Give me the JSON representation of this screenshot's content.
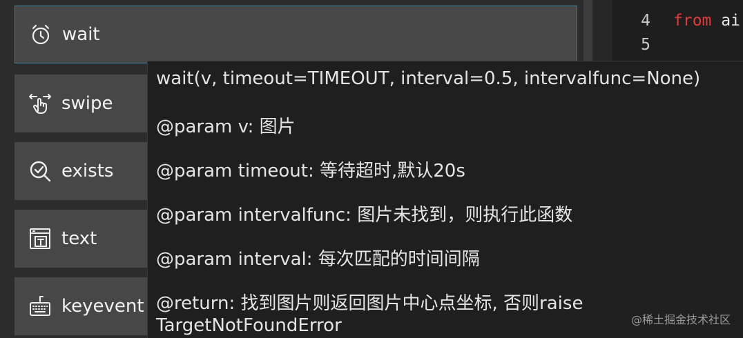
{
  "commands": [
    {
      "label": "wait",
      "icon": "alarm-clock-icon"
    },
    {
      "label": "swipe",
      "icon": "swipe-hand-icon"
    },
    {
      "label": "exists",
      "icon": "magnifier-check-icon"
    },
    {
      "label": "text",
      "icon": "text-box-icon"
    },
    {
      "label": "keyevent",
      "icon": "keyboard-icon"
    }
  ],
  "editor": {
    "lines": [
      {
        "number": "4",
        "keyword": "from",
        "rest": "ai"
      },
      {
        "number": "5",
        "keyword": "",
        "rest": ""
      }
    ]
  },
  "tooltip": {
    "signature": "wait(v, timeout=TIMEOUT, interval=0.5, intervalfunc=None)",
    "param_v": "@param v: 图片",
    "param_timeout": "@param timeout: 等待超时,默认20s",
    "param_intervalfunc": "@param intervalfunc: 图片未找到，则执行此函数",
    "param_interval": "@param interval: 每次匹配的时间间隔",
    "return_line1": "@return: 找到图片则返回图片中心点坐标, 否则raise",
    "return_line2": "TargetNotFoundError"
  },
  "watermark": "@稀土掘金技术社区",
  "colors": {
    "keyword": "#e03a3a",
    "active_border": "#3a7f96",
    "button_bg": "#474747",
    "tooltip_bg": "#1f1f1f"
  }
}
